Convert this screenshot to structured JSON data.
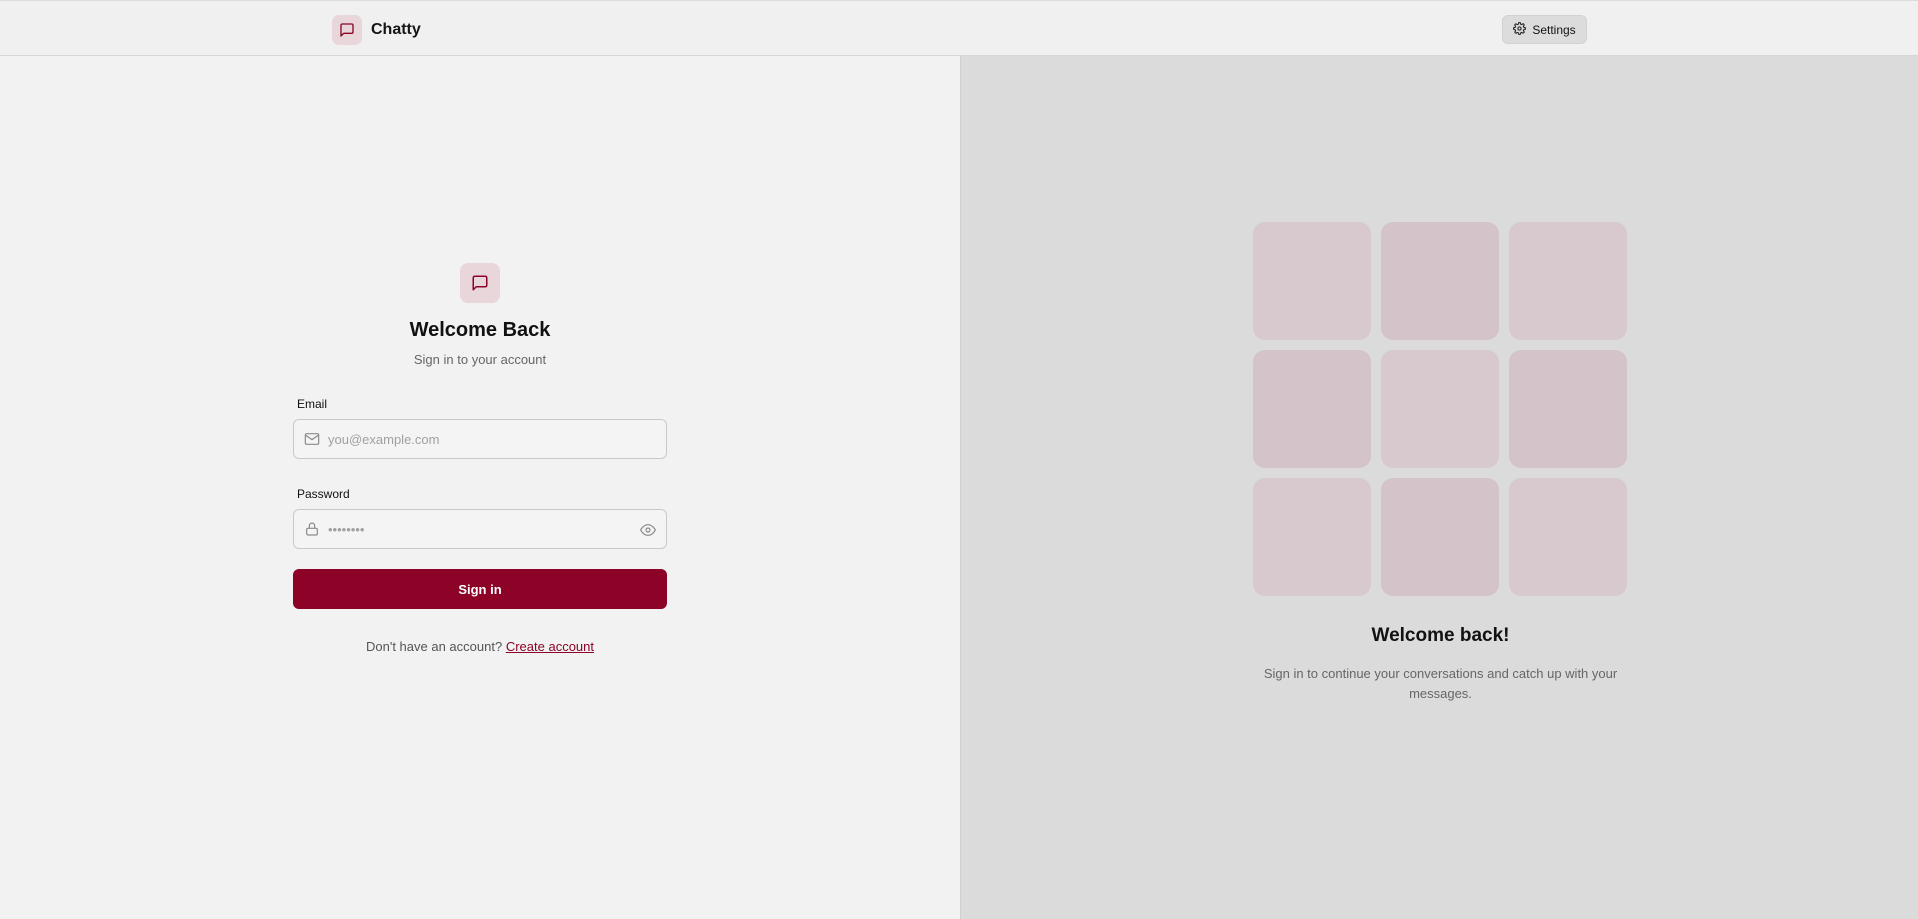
{
  "header": {
    "app_name": "Chatty",
    "settings_label": "Settings"
  },
  "login": {
    "title": "Welcome Back",
    "subtitle": "Sign in to your account",
    "email_label": "Email",
    "email_placeholder": "you@example.com",
    "email_value": "",
    "password_label": "Password",
    "password_placeholder": "••••••••",
    "password_value": "",
    "signin_label": "Sign in",
    "no_account_text": "Don't have an account?",
    "create_account_label": "Create account"
  },
  "promo": {
    "title": "Welcome back!",
    "subtitle": "Sign in to continue your conversations and catch up with your messages."
  },
  "colors": {
    "accent": "#8c0327",
    "badge_bg": "#e8d6da",
    "tile_light": "#d7c9cd",
    "tile_dark": "#d4c3c8"
  },
  "icons": {
    "brand": "message-square-icon",
    "settings": "gear-icon",
    "email": "mail-icon",
    "password": "lock-icon",
    "toggle_password": "eye-icon"
  }
}
